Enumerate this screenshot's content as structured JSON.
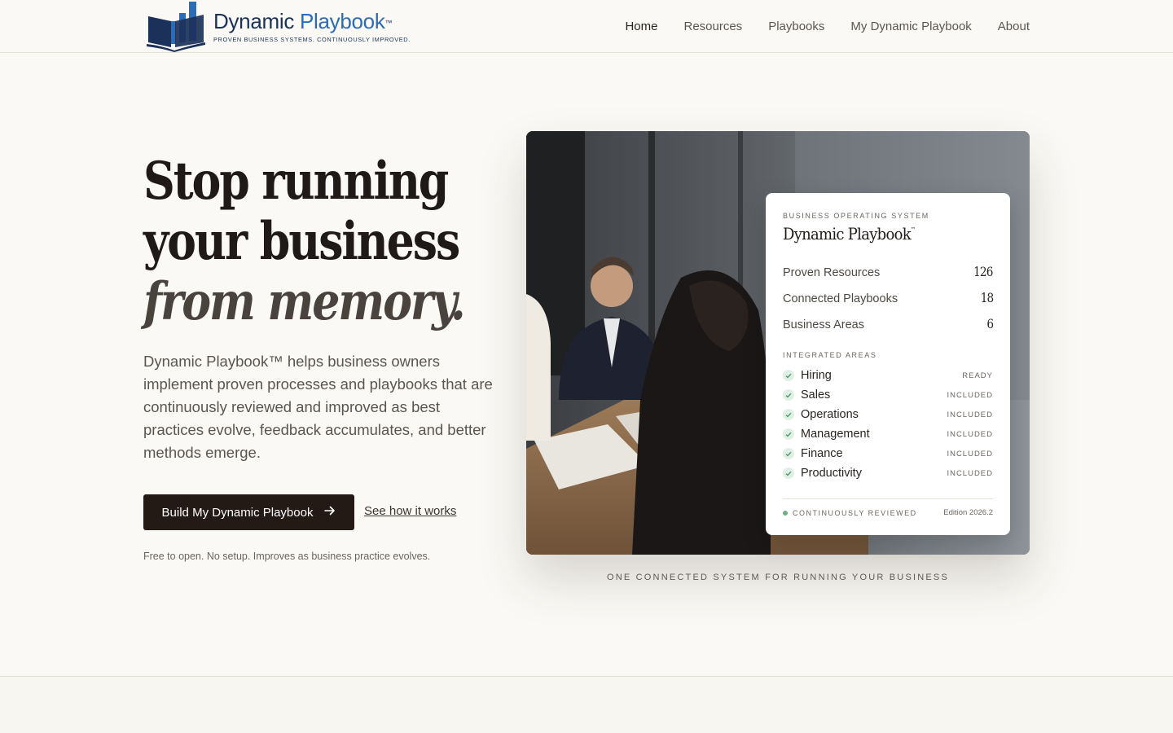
{
  "brand": {
    "name_part1": "Dynamic",
    "name_part2": "Playbook",
    "trademark": "™",
    "tagline": "PROVEN BUSINESS SYSTEMS. CONTINUOUSLY IMPROVED.",
    "primary_color": "#1c3159",
    "accent_color": "#2b6cb6"
  },
  "nav": {
    "items": [
      {
        "label": "Home",
        "active": true
      },
      {
        "label": "Resources",
        "active": false
      },
      {
        "label": "Playbooks",
        "active": false
      },
      {
        "label": "My Dynamic Playbook",
        "active": false
      },
      {
        "label": "About",
        "active": false
      }
    ]
  },
  "hero": {
    "headline_line1": "Stop running",
    "headline_line2": "your business",
    "headline_line3": "from memory.",
    "lead": "Dynamic Playbook™ helps business owners implement proven processes and playbooks that are continuously reviewed and improved as best practices evolve, feedback accumulates, and better methods emerge.",
    "cta_label": "Build My Dynamic Playbook",
    "cta_icon": "arrow-right-icon",
    "secondary_label": "See how it works",
    "note": "Free to open. No setup. Improves as business practice evolves.",
    "cta_color": "#231915",
    "image_caption": "ONE CONNECTED SYSTEM FOR RUNNING YOUR BUSINESS"
  },
  "card": {
    "eyebrow": "BUSINESS OPERATING SYSTEM",
    "title": "Dynamic Playbook",
    "title_tm": "™",
    "stats": [
      {
        "label": "Proven Resources",
        "value": "126"
      },
      {
        "label": "Connected Playbooks",
        "value": "18"
      },
      {
        "label": "Business Areas",
        "value": "6"
      }
    ],
    "areas_label": "INTEGRATED AREAS",
    "areas": [
      {
        "name": "Hiring",
        "status": "READY"
      },
      {
        "name": "Sales",
        "status": "INCLUDED"
      },
      {
        "name": "Operations",
        "status": "INCLUDED"
      },
      {
        "name": "Management",
        "status": "INCLUDED"
      },
      {
        "name": "Finance",
        "status": "INCLUDED"
      },
      {
        "name": "Productivity",
        "status": "INCLUDED"
      }
    ],
    "footer_status": "CONTINUOUSLY REVIEWED",
    "edition": "Edition 2026.2",
    "status_color": "#6fae82"
  }
}
